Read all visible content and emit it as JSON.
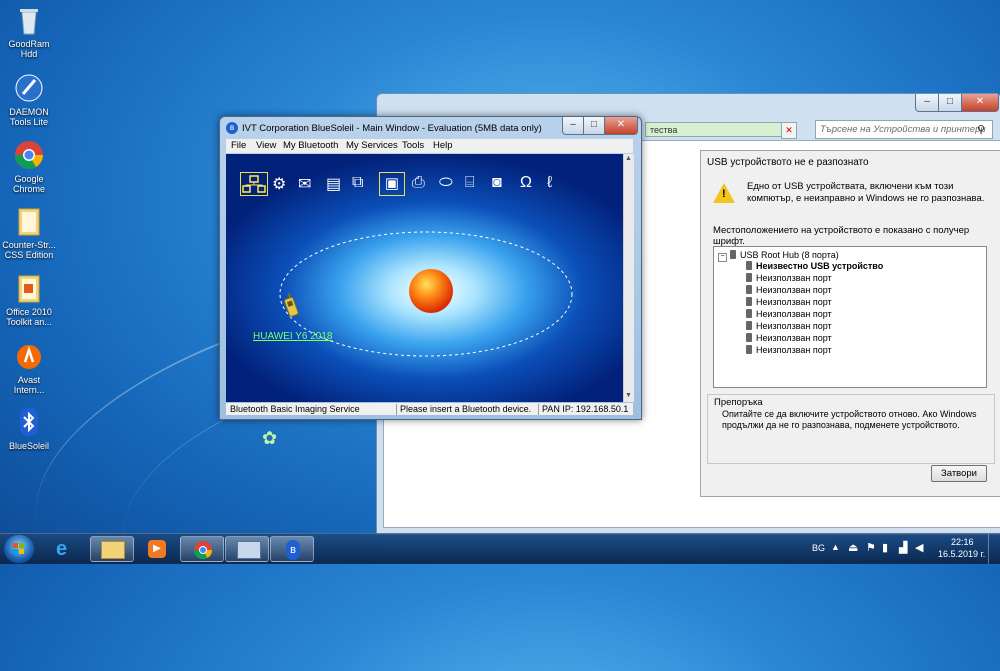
{
  "desktop": {
    "icons": [
      {
        "label": "GoodRam Hdd",
        "icon": "recycle-bin-icon"
      },
      {
        "label": "DAEMON Tools Lite",
        "icon": "daemon-tools-icon"
      },
      {
        "label": "Google Chrome",
        "icon": "chrome-icon"
      },
      {
        "label": "Counter-Str... CSS Edition",
        "icon": "folder-icon"
      },
      {
        "label": "Office 2010 Toolkit an...",
        "icon": "folder-icon"
      },
      {
        "label": "Avast Intern...",
        "icon": "avast-icon"
      },
      {
        "label": "BlueSoleil",
        "icon": "bluetooth-icon"
      }
    ]
  },
  "device_window": {
    "address_text": "тества",
    "search_placeholder": "Търсене на Устройства и принтери",
    "caption_min": "–",
    "caption_max": "□",
    "caption_close": "✕"
  },
  "usb_dialog": {
    "title": "USB устройството не е разпознато",
    "message": "Едно от USB устройствата, включени към този компютър, е неизправно и Windows не го разпознава.",
    "location_note": "Местоположението на устройството е показано с получер шрифт.",
    "tree": {
      "root": "USB Root Hub (8 порта)",
      "items": [
        {
          "label": "Неизвестно USB устройство",
          "bold": true
        },
        {
          "label": "Неизползван порт",
          "bold": false
        },
        {
          "label": "Неизползван порт",
          "bold": false
        },
        {
          "label": "Неизползван порт",
          "bold": false
        },
        {
          "label": "Неизползван порт",
          "bold": false
        },
        {
          "label": "Неизползван порт",
          "bold": false
        },
        {
          "label": "Неизползван порт",
          "bold": false
        },
        {
          "label": "Неизползван порт",
          "bold": false
        }
      ]
    },
    "recommendation_title": "Препоръка",
    "recommendation_text": "Опитайте се да включите устройството отново. Ако Windows продължи да не го разпознава, подменете устройството.",
    "close_button": "Затвори"
  },
  "bluesoleil": {
    "title": "IVT Corporation BlueSoleil - Main Window - Evaluation (5MB data only)",
    "menu": [
      "File",
      "View",
      "My Bluetooth",
      "My Services",
      "Tools",
      "Help"
    ],
    "service_icons": [
      "network-service-icon",
      "lan-access-icon",
      "fax-icon",
      "file-transfer-icon",
      "sync-icon",
      "imaging-icon",
      "printer-icon",
      "mouse-icon",
      "scanner-icon",
      "camera-icon",
      "headset-icon",
      "audio-gateway-icon"
    ],
    "device_name": "HUAWEI Y6 2018",
    "status_service": "Bluetooth Basic Imaging Service",
    "status_message": "Please insert a Bluetooth device.",
    "status_ip": "PAN IP: 192.168.50.1"
  },
  "taskbar": {
    "apps": [
      "start-orb-icon",
      "internet-explorer-icon",
      "explorer-icon",
      "media-player-icon",
      "chrome-icon",
      "devices-icon",
      "bluetooth-icon"
    ],
    "language": "BG",
    "time": "22:16",
    "date": "16.5.2019 г."
  }
}
